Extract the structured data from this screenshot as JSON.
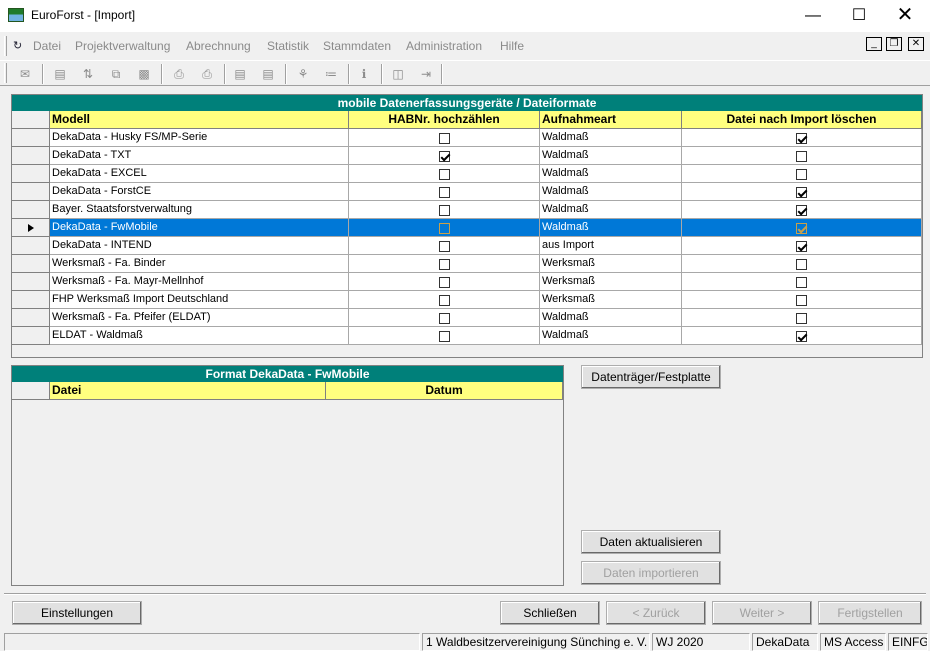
{
  "window": {
    "title": "EuroForst - [Import]"
  },
  "menu": [
    "Datei",
    "Projektverwaltung",
    "Abrechnung",
    "Statistik",
    "Stammdaten",
    "Administration",
    "Hilfe"
  ],
  "grid1": {
    "caption": "mobile Datenerfassungsgeräte  /  Dateiformate",
    "columns": [
      "Modell",
      "HABNr. hochzählen",
      "Aufnahmeart",
      "Datei nach Import löschen"
    ],
    "selected_row": 5,
    "rows": [
      {
        "model": "DekaData - Husky FS/MP-Serie",
        "hab": false,
        "art": "Waldmaß",
        "del": true
      },
      {
        "model": "DekaData - TXT",
        "hab": true,
        "art": "Waldmaß",
        "del": false
      },
      {
        "model": "DekaData - EXCEL",
        "hab": false,
        "art": "Waldmaß",
        "del": false
      },
      {
        "model": "DekaData - ForstCE",
        "hab": false,
        "art": "Waldmaß",
        "del": true
      },
      {
        "model": "Bayer. Staatsforstverwaltung",
        "hab": false,
        "art": "Waldmaß",
        "del": true
      },
      {
        "model": "DekaData - FwMobile",
        "hab": false,
        "art": "Waldmaß",
        "del": true
      },
      {
        "model": "DekaData - INTEND",
        "hab": false,
        "art": "aus Import",
        "del": true
      },
      {
        "model": "Werksmaß - Fa. Binder",
        "hab": false,
        "art": "Werksmaß",
        "del": false
      },
      {
        "model": "Werksmaß - Fa. Mayr-Mellnhof",
        "hab": false,
        "art": "Werksmaß",
        "del": false
      },
      {
        "model": "FHP Werksmaß Import Deutschland",
        "hab": false,
        "art": "Werksmaß",
        "del": false
      },
      {
        "model": "Werksmaß - Fa. Pfeifer (ELDAT)",
        "hab": false,
        "art": "Waldmaß",
        "del": false
      },
      {
        "model": "ELDAT - Waldmaß",
        "hab": false,
        "art": "Waldmaß",
        "del": true
      }
    ]
  },
  "grid2": {
    "caption": "Format   DekaData - FwMobile",
    "columns": [
      "Datei",
      "Datum"
    ]
  },
  "buttons": {
    "datentraeger": "Datenträger/Festplatte",
    "aktualisieren": "Daten aktualisieren",
    "importieren": "Daten importieren",
    "einstellungen": "Einstellungen",
    "schliessen": "Schließen",
    "zurueck": "< Zurück",
    "weiter": "Weiter >",
    "fertigstellen": "Fertigstellen"
  },
  "status": {
    "org": "1 Waldbesitzervereinigung Sünching e. V.",
    "wj": "WJ 2020",
    "source": "DekaData",
    "db": "MS Access",
    "mode": "EINFG"
  }
}
